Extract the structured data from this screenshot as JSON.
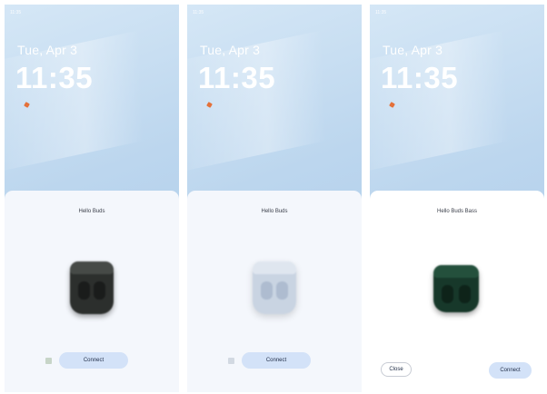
{
  "screens": [
    {
      "status_time": "11:35",
      "date": "Tue, Apr 3",
      "clock": "11:35",
      "device_name": "Hello Buds",
      "connect_label": "Connect"
    },
    {
      "status_time": "11:35",
      "date": "Tue, Apr 3",
      "clock": "11:35",
      "device_name": "Hello Buds",
      "connect_label": "Connect"
    },
    {
      "status_time": "11:35",
      "date": "Tue, Apr 3",
      "clock": "11:35",
      "device_name": "Hello Buds Bass",
      "close_label": "Close",
      "connect_label": "Connect"
    }
  ],
  "colors": {
    "sheet_background": "#f4f7fc",
    "connect_button": "#d3e2f8",
    "case_black": "#2c2f2d",
    "case_white": "#c9d4e2",
    "case_green": "#17382a",
    "weather_accent": "#e4713a"
  },
  "icons": [
    "weather-icon",
    "battery-icon"
  ]
}
